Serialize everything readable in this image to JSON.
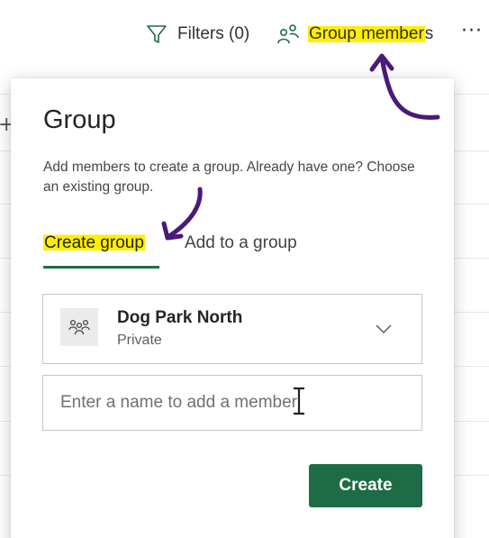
{
  "toolbar": {
    "filters_label": "Filters (0)",
    "group_members_label_highlighted": "Group member",
    "group_members_label_rest": "s",
    "more_label": "···",
    "left_plus": "+"
  },
  "panel": {
    "title": "Group",
    "description": "Add members to create a group. Already have one? Choose an existing group.",
    "tabs": [
      {
        "label": "Create group",
        "selected": true
      },
      {
        "label": "Add to a group",
        "selected": false
      }
    ],
    "group": {
      "name": "Dog Park North",
      "privacy": "Private"
    },
    "member_input": {
      "placeholder": "Enter a name to add a member",
      "value": ""
    },
    "create_button_label": "Create"
  },
  "colors": {
    "accent": "#1d6c45",
    "highlight": "#ffee00",
    "annotation": "#4a1a78"
  }
}
